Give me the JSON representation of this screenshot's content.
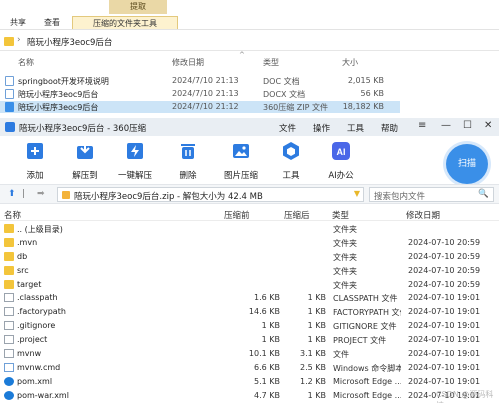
{
  "ribbon": {
    "context_tab": "提取",
    "tabs": [
      "共享",
      "查看",
      "压缩的文件夹工具"
    ]
  },
  "explorer": {
    "address": "陪玩小程序3eoc9后台",
    "columns": {
      "name": "名称",
      "date": "修改日期",
      "type": "类型",
      "size": "大小"
    },
    "files": [
      {
        "name": "springboot开发环境说明",
        "date": "2024/7/10 21:13",
        "type": "DOC 文档",
        "size": "2,015 KB"
      },
      {
        "name": "陪玩小程序3eoc9后台",
        "date": "2024/7/10 21:13",
        "type": "DOCX 文档",
        "size": "56 KB"
      },
      {
        "name": "陪玩小程序3eoc9后台",
        "date": "2024/7/10 21:12",
        "type": "360压缩 ZIP 文件",
        "size": "18,182 KB"
      }
    ]
  },
  "zip": {
    "title": "陪玩小程序3eoc9后台 - 360压缩",
    "menu": [
      "文件",
      "操作",
      "工具",
      "帮助"
    ],
    "toolbar": {
      "add": "添加",
      "extract_to": "解压到",
      "one_click": "一键解压",
      "delete": "删除",
      "image_compress": "图片压缩",
      "tools": "工具",
      "ai": "AI办公",
      "ai_badge": "AI",
      "scan": "扫描"
    },
    "path": "陪玩小程序3eoc9后台.zip - 解包大小为 42.4 MB",
    "search_placeholder": "搜索包内文件",
    "columns": {
      "name": "名称",
      "before": "压缩前",
      "after": "压缩后",
      "type": "类型",
      "date": "修改日期"
    },
    "rows": [
      {
        "icon": "folder",
        "name": ".. (上级目录)",
        "before": "",
        "after": "",
        "type": "文件夹",
        "date": ""
      },
      {
        "icon": "folder",
        "name": ".mvn",
        "before": "",
        "after": "",
        "type": "文件夹",
        "date": "2024-07-10 20:59"
      },
      {
        "icon": "folder",
        "name": "db",
        "before": "",
        "after": "",
        "type": "文件夹",
        "date": "2024-07-10 20:59"
      },
      {
        "icon": "folder",
        "name": "src",
        "before": "",
        "after": "",
        "type": "文件夹",
        "date": "2024-07-10 20:59"
      },
      {
        "icon": "folder",
        "name": "target",
        "before": "",
        "after": "",
        "type": "文件夹",
        "date": "2024-07-10 20:59"
      },
      {
        "icon": "file",
        "name": ".classpath",
        "before": "1.6 KB",
        "after": "1 KB",
        "type": "CLASSPATH 文件",
        "date": "2024-07-10 19:01"
      },
      {
        "icon": "file",
        "name": ".factorypath",
        "before": "14.6 KB",
        "after": "1 KB",
        "type": "FACTORYPATH 文件",
        "date": "2024-07-10 19:01"
      },
      {
        "icon": "file",
        "name": ".gitignore",
        "before": "1 KB",
        "after": "1 KB",
        "type": "GITIGNORE 文件",
        "date": "2024-07-10 19:01"
      },
      {
        "icon": "file",
        "name": ".project",
        "before": "1 KB",
        "after": "1 KB",
        "type": "PROJECT 文件",
        "date": "2024-07-10 19:01"
      },
      {
        "icon": "file",
        "name": "mvnw",
        "before": "10.1 KB",
        "after": "3.1 KB",
        "type": "文件",
        "date": "2024-07-10 19:01"
      },
      {
        "icon": "doc",
        "name": "mvnw.cmd",
        "before": "6.6 KB",
        "after": "2.5 KB",
        "type": "Windows 命令脚本",
        "date": "2024-07-10 19:01"
      },
      {
        "icon": "edge",
        "name": "pom.xml",
        "before": "5.1 KB",
        "after": "1.2 KB",
        "type": "Microsoft Edge ...",
        "date": "2024-07-10 19:01"
      },
      {
        "icon": "edge",
        "name": "pom-war.xml",
        "before": "4.7 KB",
        "after": "1 KB",
        "type": "Microsoft Edge ...",
        "date": "2024-07-10 19:01"
      }
    ]
  },
  "watermark": "CSDN @源码科技",
  "colors": {
    "accent": "#2d7be0",
    "selection": "#cce4f7",
    "folder": "#f3c53b",
    "context_tab": "#ead8a6"
  }
}
